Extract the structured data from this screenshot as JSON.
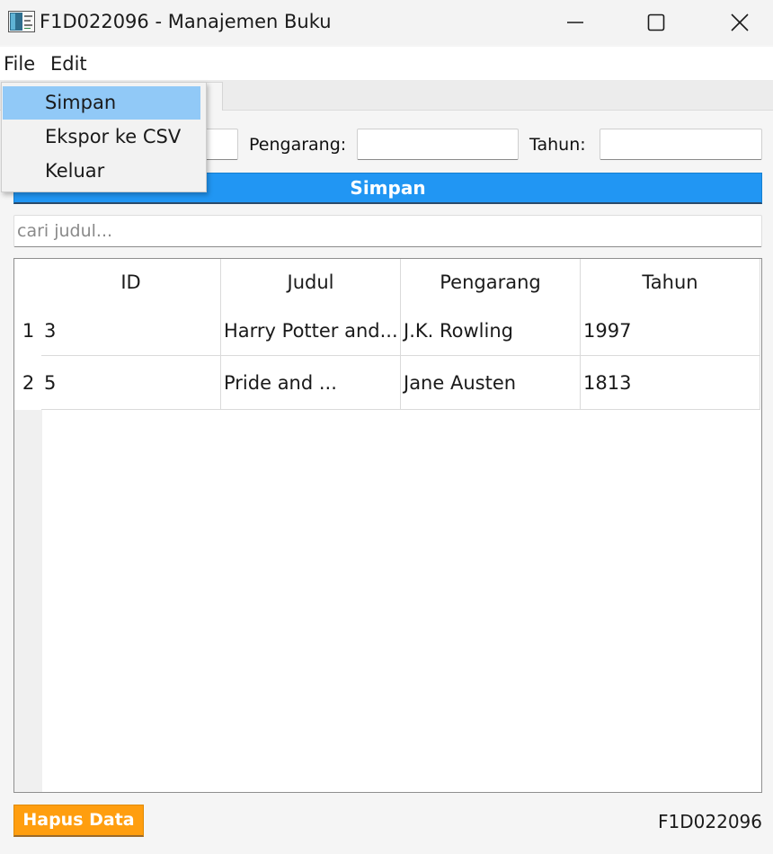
{
  "window": {
    "title": "F1D022096 - Manajemen Buku",
    "icon": "app-window-icon",
    "controls": [
      "minimize-icon",
      "maximize-icon",
      "close-icon"
    ]
  },
  "menubar": {
    "items": [
      "File",
      "Edit"
    ]
  },
  "file_menu": {
    "items": [
      "Simpan",
      "Ekspor ke CSV",
      "Keluar"
    ],
    "highlighted": "Simpan"
  },
  "form": {
    "pengarang_label": "Pengarang:",
    "pengarang_value": "",
    "tahun_label": "Tahun:",
    "tahun_value": "",
    "judul_value": "",
    "save_label": "Simpan"
  },
  "search": {
    "placeholder": "cari judul..."
  },
  "table": {
    "columns": [
      "ID",
      "Judul",
      "Pengarang",
      "Tahun"
    ],
    "rows": [
      {
        "num": "1",
        "id": "3",
        "judul": "Harry Potter and...",
        "pengarang": "J.K. Rowling",
        "tahun": "1997"
      },
      {
        "num": "2",
        "id": "5",
        "judul": "Pride and ...",
        "pengarang": "Jane Austen",
        "tahun": "1813"
      }
    ]
  },
  "footer": {
    "delete_label": "Hapus Data",
    "student_id": "F1D022096"
  },
  "colors": {
    "primary_button": "#2196f3",
    "delete_button": "#ff9e0f",
    "menu_highlight": "#91c9f7"
  }
}
